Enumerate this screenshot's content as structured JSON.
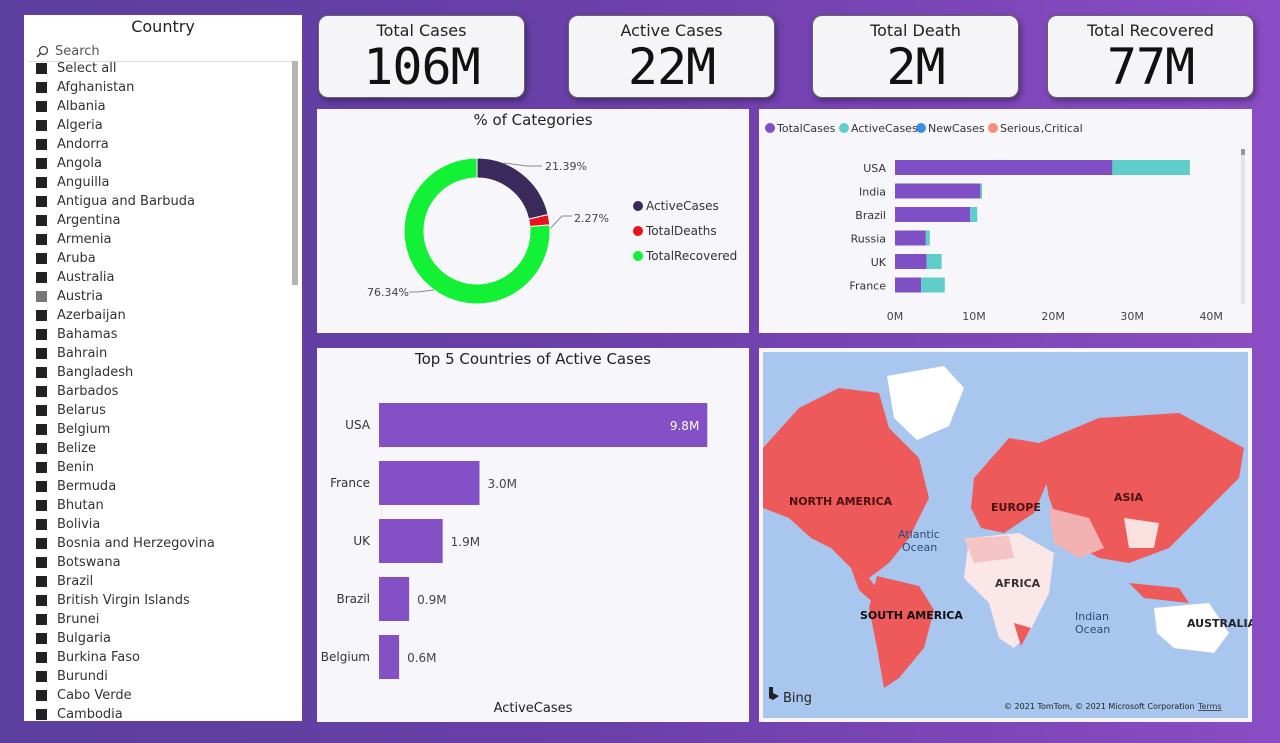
{
  "slicer": {
    "title": "Country",
    "search_placeholder": "Search",
    "items": [
      "Select all",
      "Afghanistan",
      "Albania",
      "Algeria",
      "Andorra",
      "Angola",
      "Anguilla",
      "Antigua and Barbuda",
      "Argentina",
      "Armenia",
      "Aruba",
      "Australia",
      "Austria",
      "Azerbaijan",
      "Bahamas",
      "Bahrain",
      "Bangladesh",
      "Barbados",
      "Belarus",
      "Belgium",
      "Belize",
      "Benin",
      "Bermuda",
      "Bhutan",
      "Bolivia",
      "Bosnia and Herzegovina",
      "Botswana",
      "Brazil",
      "British Virgin Islands",
      "Brunei",
      "Bulgaria",
      "Burkina Faso",
      "Burundi",
      "Cabo Verde",
      "Cambodia"
    ]
  },
  "kpis": [
    {
      "label": "Total Cases",
      "value": "106M"
    },
    {
      "label": "Active Cases",
      "value": "22M"
    },
    {
      "label": "Total Death",
      "value": "2M"
    },
    {
      "label": "Total Recovered",
      "value": "77M"
    }
  ],
  "colors": {
    "active": "#3a2a5c",
    "deaths": "#e8111d",
    "recovered": "#13f136",
    "totalcases": "#7f4fc6",
    "activecases": "#5fcdc9",
    "newcases": "#3a8ee6",
    "serious": "#f4907a",
    "bar": "#8350c6"
  },
  "chart_data": [
    {
      "type": "pie",
      "title": "% of Categories",
      "categories": [
        "ActiveCases",
        "TotalDeaths",
        "TotalRecovered"
      ],
      "values": [
        21.39,
        2.27,
        76.34
      ],
      "labels": [
        "21.39%",
        "2.27%",
        "76.34%"
      ],
      "legend": "right"
    },
    {
      "type": "bar",
      "title": "",
      "categories": [
        "USA",
        "India",
        "Brazil",
        "Russia",
        "UK",
        "France"
      ],
      "series": [
        {
          "name": "TotalCases",
          "values": [
            27.5,
            10.8,
            9.5,
            3.9,
            4.0,
            3.3
          ]
        },
        {
          "name": "ActiveCases",
          "values": [
            9.8,
            0.2,
            0.9,
            0.5,
            1.9,
            3.0
          ]
        },
        {
          "name": "NewCases",
          "values": [
            0,
            0,
            0,
            0,
            0,
            0
          ]
        },
        {
          "name": "Serious,Critical",
          "values": [
            0,
            0,
            0,
            0,
            0,
            0
          ]
        }
      ],
      "xticks": [
        "0M",
        "10M",
        "20M",
        "30M",
        "40M"
      ],
      "xlim": [
        0,
        42
      ],
      "legend": "top-left"
    },
    {
      "type": "bar",
      "title": "Top 5 Countries of Active Cases",
      "categories": [
        "USA",
        "France",
        "UK",
        "Brazil",
        "Belgium"
      ],
      "values": [
        9.8,
        3.0,
        1.9,
        0.9,
        0.6
      ],
      "labels": [
        "9.8M",
        "3.0M",
        "1.9M",
        "0.9M",
        "0.6M"
      ],
      "xlabel": "ActiveCases",
      "xlim": [
        0,
        10
      ]
    }
  ],
  "map": {
    "labels": [
      "NORTH AMERICA",
      "EUROPE",
      "ASIA",
      "AFRICA",
      "SOUTH AMERICA",
      "AUSTRALIA"
    ],
    "oceans": [
      "Atlantic",
      "Ocean",
      "Indian",
      "Ocean"
    ],
    "bing": "Bing",
    "attribution": "© 2021 TomTom, © 2021 Microsoft Corporation",
    "terms": "Terms"
  }
}
